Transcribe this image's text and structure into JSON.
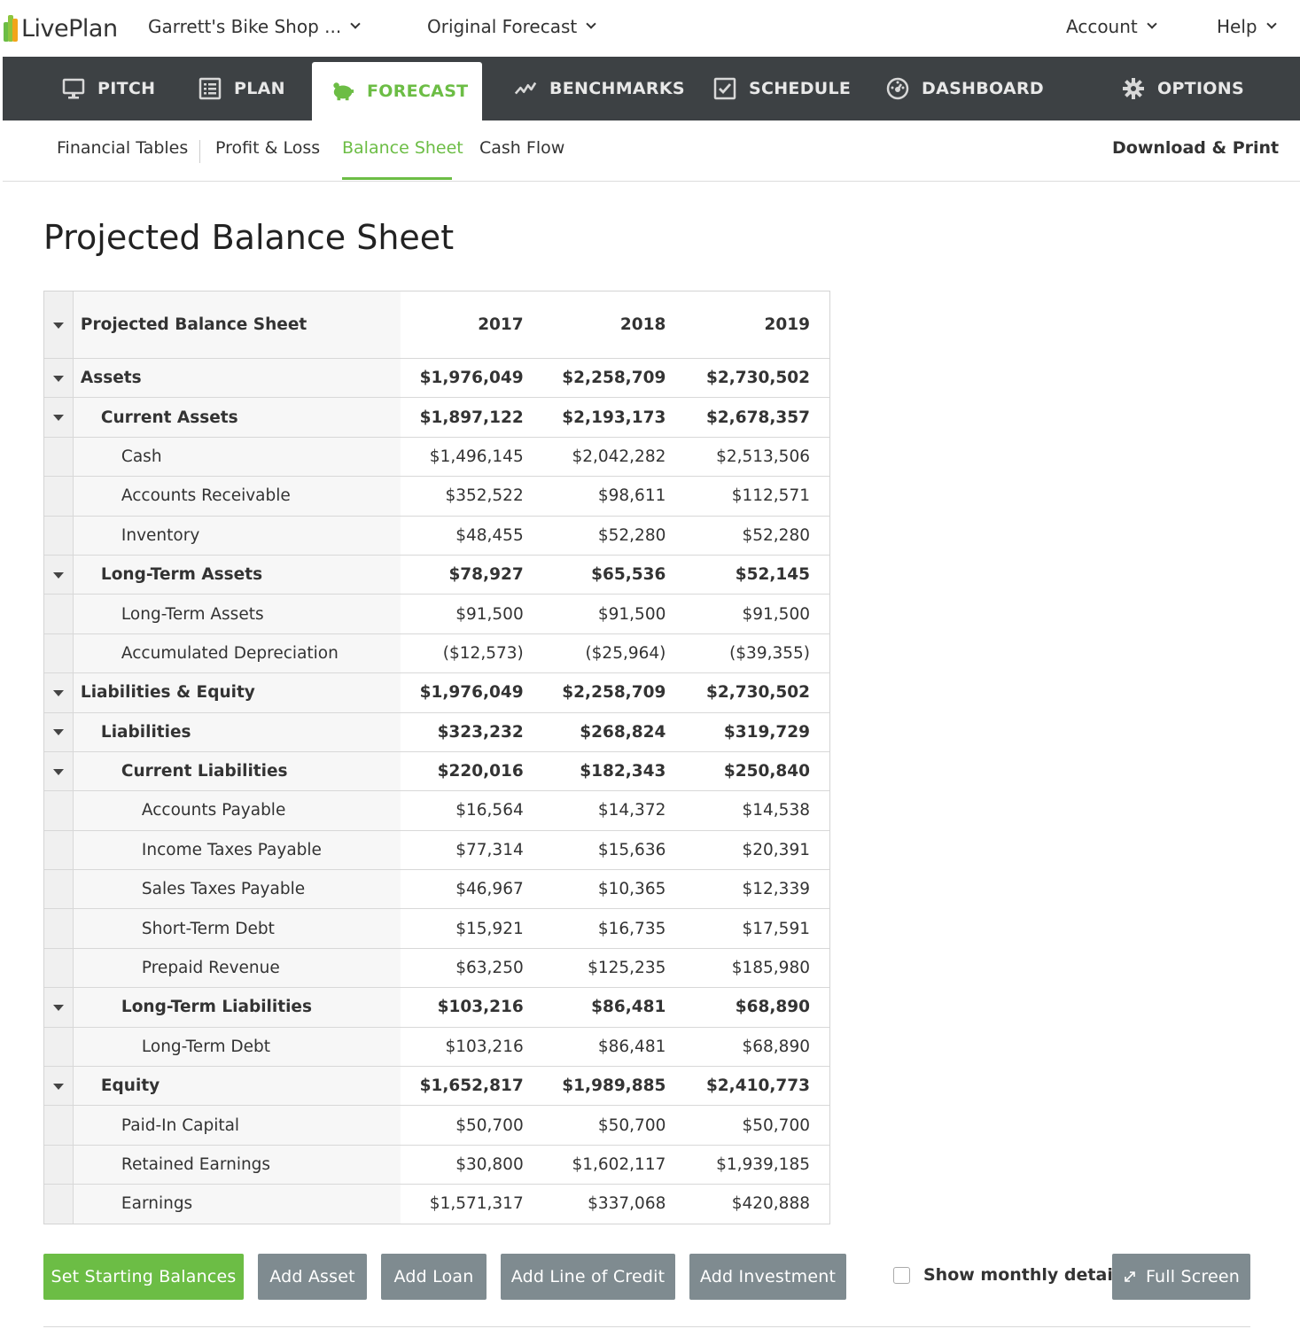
{
  "brand": {
    "name": "LivePlan"
  },
  "top": {
    "company": "Garrett's Bike Shop ...",
    "forecast": "Original Forecast",
    "account": "Account",
    "help": "Help"
  },
  "nav": {
    "pitch": "PITCH",
    "plan": "PLAN",
    "forecast": "FORECAST",
    "benchmarks": "BENCHMARKS",
    "schedule": "SCHEDULE",
    "dashboard": "DASHBOARD",
    "options": "OPTIONS"
  },
  "subnav": {
    "financial_tables": "Financial Tables",
    "profit_loss": "Profit & Loss",
    "balance_sheet": "Balance Sheet",
    "cash_flow": "Cash Flow",
    "download_print": "Download & Print"
  },
  "page_title": "Projected Balance Sheet",
  "table": {
    "header": {
      "label": "Projected Balance Sheet",
      "years": [
        "2017",
        "2018",
        "2019"
      ]
    },
    "rows": [
      {
        "label": "Assets",
        "values": [
          "$1,976,049",
          "$2,258,709",
          "$2,730,502"
        ]
      },
      {
        "label": "Current Assets",
        "values": [
          "$1,897,122",
          "$2,193,173",
          "$2,678,357"
        ]
      },
      {
        "label": "Cash",
        "values": [
          "$1,496,145",
          "$2,042,282",
          "$2,513,506"
        ]
      },
      {
        "label": "Accounts Receivable",
        "values": [
          "$352,522",
          "$98,611",
          "$112,571"
        ]
      },
      {
        "label": "Inventory",
        "values": [
          "$48,455",
          "$52,280",
          "$52,280"
        ]
      },
      {
        "label": "Long-Term Assets",
        "values": [
          "$78,927",
          "$65,536",
          "$52,145"
        ]
      },
      {
        "label": "Long-Term Assets",
        "values": [
          "$91,500",
          "$91,500",
          "$91,500"
        ]
      },
      {
        "label": "Accumulated Depreciation",
        "values": [
          "($12,573)",
          "($25,964)",
          "($39,355)"
        ]
      },
      {
        "label": "Liabilities & Equity",
        "values": [
          "$1,976,049",
          "$2,258,709",
          "$2,730,502"
        ]
      },
      {
        "label": "Liabilities",
        "values": [
          "$323,232",
          "$268,824",
          "$319,729"
        ]
      },
      {
        "label": "Current Liabilities",
        "values": [
          "$220,016",
          "$182,343",
          "$250,840"
        ]
      },
      {
        "label": "Accounts Payable",
        "values": [
          "$16,564",
          "$14,372",
          "$14,538"
        ]
      },
      {
        "label": "Income Taxes Payable",
        "values": [
          "$77,314",
          "$15,636",
          "$20,391"
        ]
      },
      {
        "label": "Sales Taxes Payable",
        "values": [
          "$46,967",
          "$10,365",
          "$12,339"
        ]
      },
      {
        "label": "Short-Term Debt",
        "values": [
          "$15,921",
          "$16,735",
          "$17,591"
        ]
      },
      {
        "label": "Prepaid Revenue",
        "values": [
          "$63,250",
          "$125,235",
          "$185,980"
        ]
      },
      {
        "label": "Long-Term Liabilities",
        "values": [
          "$103,216",
          "$86,481",
          "$68,890"
        ]
      },
      {
        "label": "Long-Term Debt",
        "values": [
          "$103,216",
          "$86,481",
          "$68,890"
        ]
      },
      {
        "label": "Equity",
        "values": [
          "$1,652,817",
          "$1,989,885",
          "$2,410,773"
        ]
      },
      {
        "label": "Paid-In Capital",
        "values": [
          "$50,700",
          "$50,700",
          "$50,700"
        ]
      },
      {
        "label": "Retained Earnings",
        "values": [
          "$30,800",
          "$1,602,117",
          "$1,939,185"
        ]
      },
      {
        "label": "Earnings",
        "values": [
          "$1,571,317",
          "$337,068",
          "$420,888"
        ]
      }
    ]
  },
  "buttons": {
    "set_starting_balances": "Set Starting Balances",
    "add_asset": "Add Asset",
    "add_loan": "Add Loan",
    "add_line_of_credit": "Add Line of Credit",
    "add_investment": "Add Investment",
    "show_monthly_detail": "Show monthly detail",
    "full_screen": "Full Screen"
  },
  "colors": {
    "accent": "#6cbd45",
    "nav_bg": "#3d4144",
    "button_gray": "#7f8b90"
  }
}
